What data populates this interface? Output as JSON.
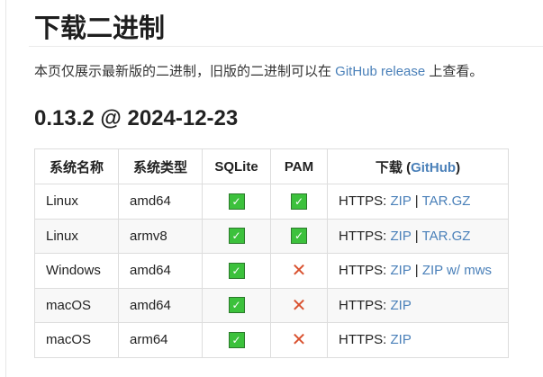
{
  "title": "下载二进制",
  "intro": {
    "before": "本页仅展示最新版的二进制，旧版的二进制可以在 ",
    "link": "GitHub release",
    "after": " 上查看。"
  },
  "version_heading": "0.13.2 @ 2024-12-23",
  "table": {
    "headers": {
      "os": "系统名称",
      "arch": "系统类型",
      "sqlite": "SQLite",
      "pam": "PAM",
      "download": "下载 (",
      "download_link": "GitHub",
      "download_close": ")"
    },
    "rows": [
      {
        "os": "Linux",
        "arch": "amd64",
        "sqlite": true,
        "pam": true,
        "prefix": "HTTPS: ",
        "links": [
          "ZIP",
          "TAR.GZ"
        ]
      },
      {
        "os": "Linux",
        "arch": "armv8",
        "sqlite": true,
        "pam": true,
        "prefix": "HTTPS: ",
        "links": [
          "ZIP",
          "TAR.GZ"
        ]
      },
      {
        "os": "Windows",
        "arch": "amd64",
        "sqlite": true,
        "pam": false,
        "prefix": "HTTPS: ",
        "links": [
          "ZIP",
          "ZIP w/ mws"
        ]
      },
      {
        "os": "macOS",
        "arch": "amd64",
        "sqlite": true,
        "pam": false,
        "prefix": "HTTPS: ",
        "links": [
          "ZIP"
        ]
      },
      {
        "os": "macOS",
        "arch": "arm64",
        "sqlite": true,
        "pam": false,
        "prefix": "HTTPS: ",
        "links": [
          "ZIP"
        ]
      }
    ],
    "separator": " | ",
    "check_glyph": "✓",
    "cross_glyph": "✕"
  },
  "colors": {
    "link": "#4a80b9",
    "check": "#3cc13c",
    "cross": "#d9512f"
  }
}
